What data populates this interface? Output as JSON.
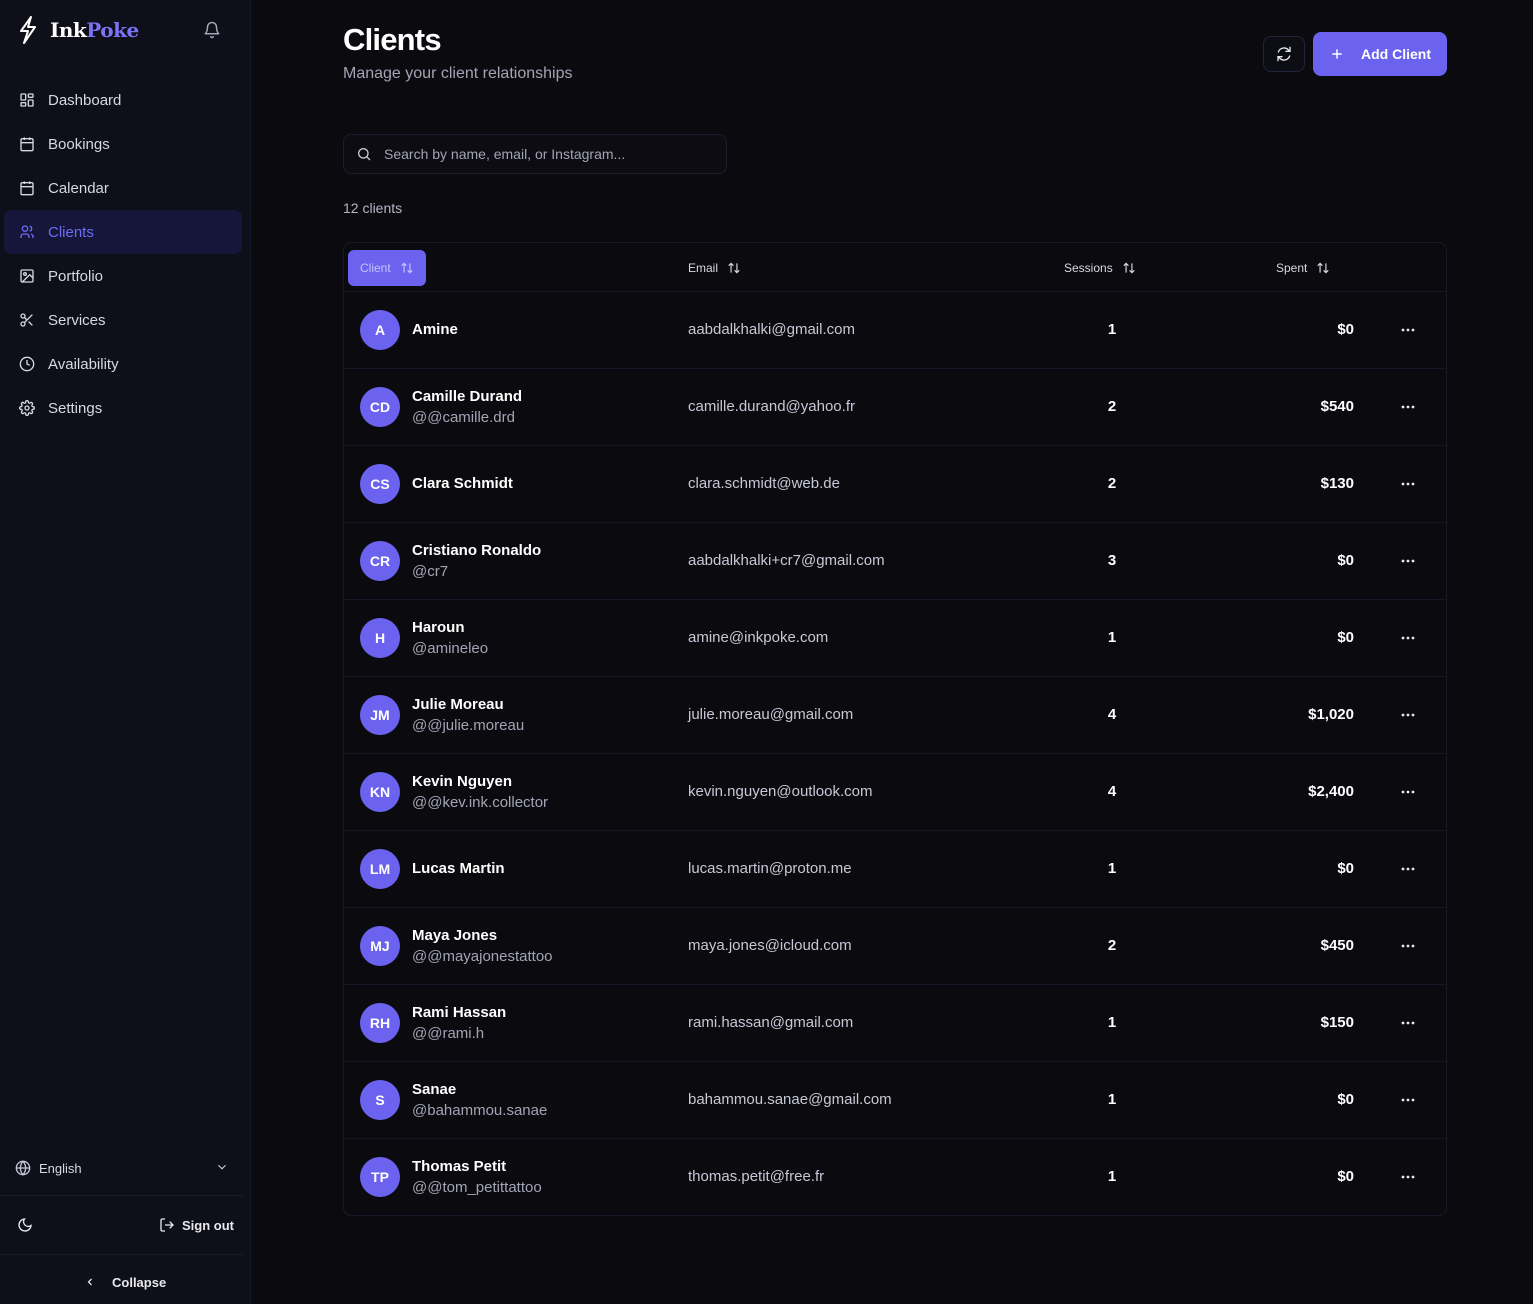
{
  "brand": {
    "ink": "Ink",
    "poke": "Poke"
  },
  "nav": [
    {
      "label": "Dashboard",
      "icon": "dashboard-grid-icon"
    },
    {
      "label": "Bookings",
      "icon": "calendar-grid-icon"
    },
    {
      "label": "Calendar",
      "icon": "calendar-icon"
    },
    {
      "label": "Clients",
      "icon": "users-icon",
      "active": true
    },
    {
      "label": "Portfolio",
      "icon": "image-icon"
    },
    {
      "label": "Services",
      "icon": "scissors-icon"
    },
    {
      "label": "Availability",
      "icon": "clock-icon"
    },
    {
      "label": "Settings",
      "icon": "gear-icon"
    }
  ],
  "footer": {
    "language": "English",
    "sign_out": "Sign out",
    "collapse": "Collapse"
  },
  "header": {
    "title": "Clients",
    "subtitle": "Manage your client relationships",
    "add_label": "Add Client"
  },
  "search": {
    "placeholder": "Search by name, email, or Instagram...",
    "value": ""
  },
  "count_label": "12 clients",
  "table": {
    "columns": [
      "Client",
      "Email",
      "Sessions",
      "Spent"
    ],
    "rows": [
      {
        "initials": "A",
        "name": "Amine",
        "handle": "",
        "email": "aabdalkhalki@gmail.com",
        "sessions": "1",
        "spent": "$0"
      },
      {
        "initials": "CD",
        "name": "Camille Durand",
        "handle": "@@camille.drd",
        "email": "camille.durand@yahoo.fr",
        "sessions": "2",
        "spent": "$540"
      },
      {
        "initials": "CS",
        "name": "Clara Schmidt",
        "handle": "",
        "email": "clara.schmidt@web.de",
        "sessions": "2",
        "spent": "$130"
      },
      {
        "initials": "CR",
        "name": "Cristiano Ronaldo",
        "handle": "@cr7",
        "email": "aabdalkhalki+cr7@gmail.com",
        "sessions": "3",
        "spent": "$0"
      },
      {
        "initials": "H",
        "name": "Haroun",
        "handle": "@amineleo",
        "email": "amine@inkpoke.com",
        "sessions": "1",
        "spent": "$0"
      },
      {
        "initials": "JM",
        "name": "Julie Moreau",
        "handle": "@@julie.moreau",
        "email": "julie.moreau@gmail.com",
        "sessions": "4",
        "spent": "$1,020"
      },
      {
        "initials": "KN",
        "name": "Kevin Nguyen",
        "handle": "@@kev.ink.collector",
        "email": "kevin.nguyen@outlook.com",
        "sessions": "4",
        "spent": "$2,400"
      },
      {
        "initials": "LM",
        "name": "Lucas Martin",
        "handle": "",
        "email": "lucas.martin@proton.me",
        "sessions": "1",
        "spent": "$0"
      },
      {
        "initials": "MJ",
        "name": "Maya Jones",
        "handle": "@@mayajonestattoo",
        "email": "maya.jones@icloud.com",
        "sessions": "2",
        "spent": "$450"
      },
      {
        "initials": "RH",
        "name": "Rami Hassan",
        "handle": "@@rami.h",
        "email": "rami.hassan@gmail.com",
        "sessions": "1",
        "spent": "$150"
      },
      {
        "initials": "S",
        "name": "Sanae",
        "handle": "@bahammou.sanae",
        "email": "bahammou.sanae@gmail.com",
        "sessions": "1",
        "spent": "$0"
      },
      {
        "initials": "TP",
        "name": "Thomas Petit",
        "handle": "@@tom_petittattoo",
        "email": "thomas.petit@free.fr",
        "sessions": "1",
        "spent": "$0"
      }
    ]
  },
  "colors": {
    "accent": "#6b63f0",
    "background": "#0b0b0f",
    "sidebar": "#0e0f18"
  }
}
